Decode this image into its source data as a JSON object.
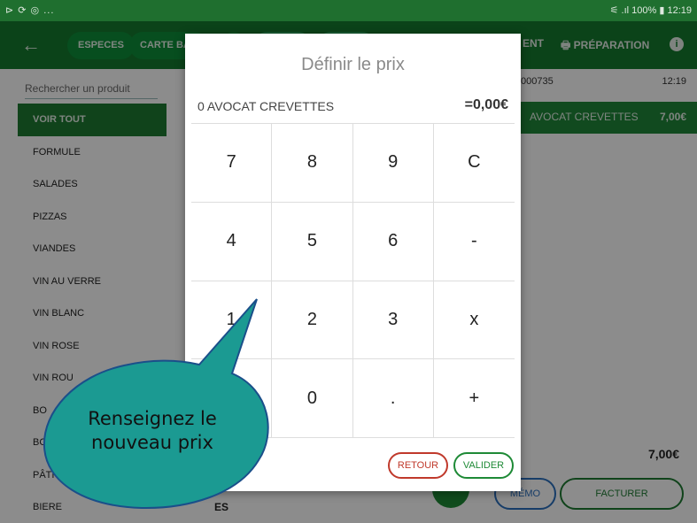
{
  "statusbar": {
    "left": "⊳ ⟳ ◎ ...",
    "right": "⚟ .ıl 100% ▮ 12:19"
  },
  "header": {
    "pills": [
      "ESPECES",
      "CARTE BAN"
    ],
    "right_items": [
      "ENT",
      "PRÉPARATION"
    ]
  },
  "search": {
    "placeholder": "Rechercher un produit"
  },
  "categories": [
    "VOIR TOUT",
    "FORMULE",
    "SALADES",
    "PIZZAS",
    "VIANDES",
    "VIN AU VERRE",
    "VIN BLANC",
    "VIN ROSE",
    "VIN ROU",
    "BO",
    "BC",
    "PÂTI",
    "BIERE"
  ],
  "ticket": {
    "number": "000735",
    "time": "12:19",
    "item_name": "AVOCAT CREVETTES",
    "item_price": "7,00€",
    "total": "7,00€",
    "memo": "MÉMO",
    "facturer": "FACTURER",
    "bottom_text": "ES"
  },
  "dialog": {
    "title": "Définir le prix",
    "product": "0 AVOCAT CREVETTES",
    "price": "=0,00€",
    "keys": [
      "7",
      "8",
      "9",
      "C",
      "4",
      "5",
      "6",
      "-",
      "1",
      "2",
      "3",
      "x",
      "",
      "0",
      ".",
      "+"
    ],
    "retour": "RETOUR",
    "valider": "VALIDER"
  },
  "annotation": {
    "line1": "Renseignez le",
    "line2": "nouveau prix"
  },
  "colors": {
    "green_dark": "#147a2e",
    "bubble_fill": "#1b9a92",
    "red": "#c0392b",
    "blue": "#2b6fbd"
  }
}
